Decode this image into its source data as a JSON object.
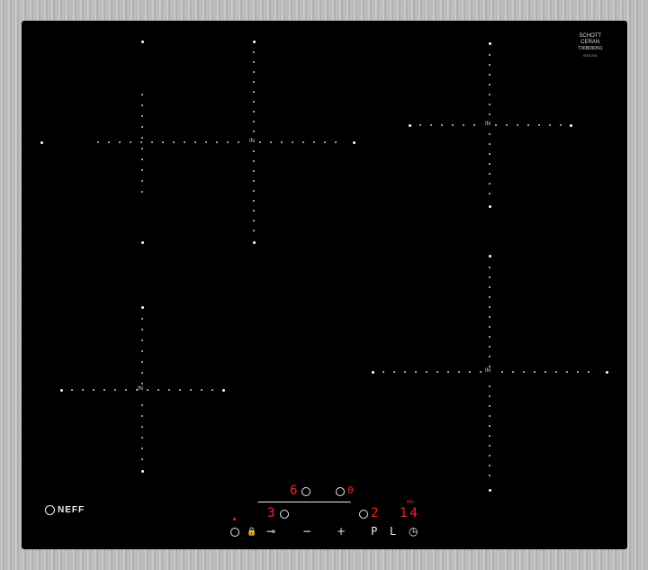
{
  "brand": "NEFF",
  "glass_maker": {
    "line1": "SCHOTT",
    "line2": "CERAN",
    "model": "T36BD60N1",
    "sub": "0001234"
  },
  "zone_marker_label": "IN",
  "displays": {
    "zone_rear_left_level": "6",
    "zone_rear_right_level": "0",
    "zone_front_left_level": "3",
    "zone_front_right_level": "2",
    "timer_value": "14",
    "timer_unit": "Min"
  },
  "controls": {
    "power": "⏻",
    "childlock": "🔒",
    "key": "⊸",
    "minus": "−",
    "plus": "+",
    "p_label": "P",
    "l_label": "L",
    "timer_icon": "◷"
  },
  "colors": {
    "glass": "#000000",
    "frame": "#b9b9b9",
    "display": "#ff2020"
  }
}
